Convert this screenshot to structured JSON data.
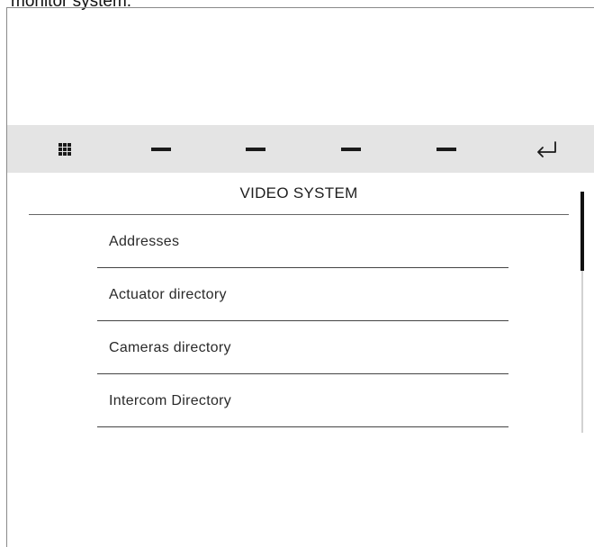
{
  "caption": "monitor system.",
  "toolbar": {
    "items": [
      {
        "icon": "grid-icon"
      },
      {
        "icon": "dash-icon"
      },
      {
        "icon": "dash-icon"
      },
      {
        "icon": "dash-icon"
      },
      {
        "icon": "dash-icon"
      },
      {
        "icon": "return-arrow-icon"
      }
    ]
  },
  "panel": {
    "title": "VIDEO SYSTEM",
    "items": [
      {
        "label": "Addresses"
      },
      {
        "label": "Actuator directory"
      },
      {
        "label": "Cameras directory"
      },
      {
        "label": "Intercom Directory"
      }
    ]
  },
  "scrollbar": {
    "position": 0,
    "visible_fraction": 0.33
  }
}
